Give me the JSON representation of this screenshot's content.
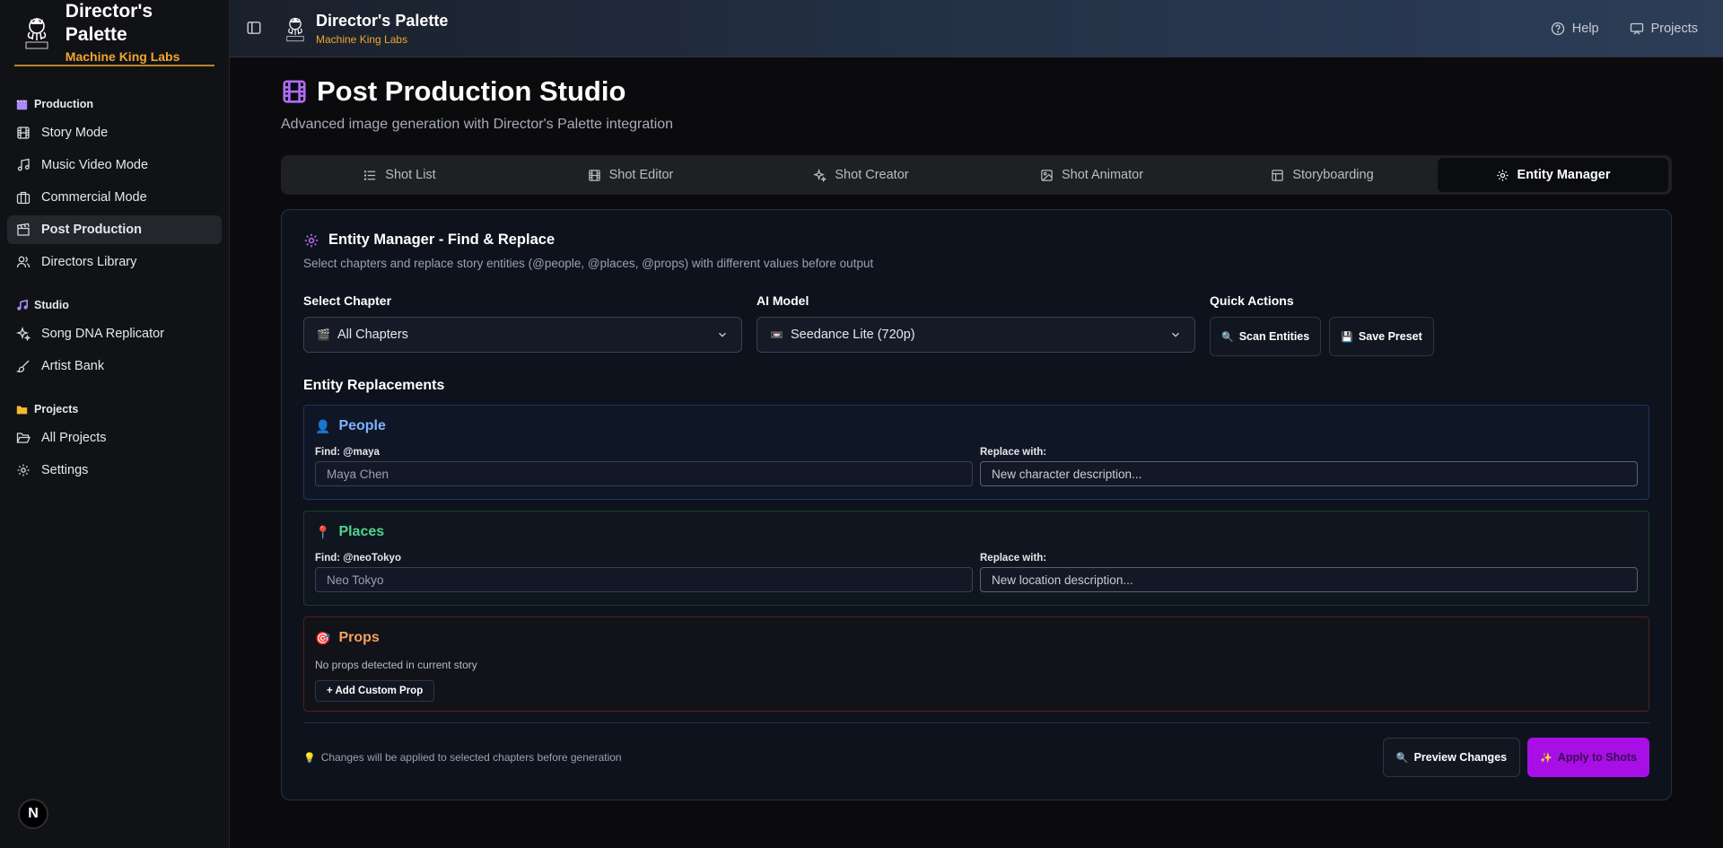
{
  "app": {
    "title": "Director's Palette",
    "subtitle": "Machine King Labs",
    "logo_text": "MACHINE KING LABS"
  },
  "sidebar": {
    "groups": [
      {
        "label": "Production",
        "icon": "clapperboard-icon",
        "items": [
          {
            "label": "Story Mode",
            "icon": "film-icon"
          },
          {
            "label": "Music Video Mode",
            "icon": "music-icon"
          },
          {
            "label": "Commercial Mode",
            "icon": "briefcase-icon"
          },
          {
            "label": "Post Production",
            "icon": "clapperboard-icon",
            "active": true
          },
          {
            "label": "Directors Library",
            "icon": "users-icon"
          }
        ]
      },
      {
        "label": "Studio",
        "icon": "music-note-icon",
        "items": [
          {
            "label": "Song DNA Replicator",
            "icon": "sparkles-icon"
          },
          {
            "label": "Artist Bank",
            "icon": "brush-icon"
          }
        ]
      },
      {
        "label": "Projects",
        "icon": "folder-icon",
        "items": [
          {
            "label": "All Projects",
            "icon": "folder-open-icon"
          },
          {
            "label": "Settings",
            "icon": "gear-icon"
          }
        ]
      }
    ],
    "user_badge": "N"
  },
  "topbar": {
    "title": "Director's Palette",
    "subtitle": "Machine King Labs",
    "links": [
      {
        "label": "Help",
        "icon": "help-circle-icon"
      },
      {
        "label": "Projects",
        "icon": "presentation-icon"
      }
    ]
  },
  "page": {
    "title": "Post Production Studio",
    "subtitle": "Advanced image generation with Director's Palette integration",
    "tabs": [
      {
        "label": "Shot List",
        "icon": "list-icon"
      },
      {
        "label": "Shot Editor",
        "icon": "film-icon"
      },
      {
        "label": "Shot Creator",
        "icon": "sparkles-icon"
      },
      {
        "label": "Shot Animator",
        "icon": "image-icon"
      },
      {
        "label": "Storyboarding",
        "icon": "layout-icon"
      },
      {
        "label": "Entity Manager",
        "icon": "gear-icon",
        "active": true
      }
    ]
  },
  "entity_manager": {
    "title": "Entity Manager - Find & Replace",
    "description": "Select chapters and replace story entities (@people, @places, @props) with different values before output",
    "select_chapter": {
      "label": "Select Chapter",
      "value": "All Chapters",
      "emoji": "🎬"
    },
    "ai_model": {
      "label": "AI Model",
      "value": "Seedance Lite (720p)",
      "emoji": "📼"
    },
    "quick_actions": {
      "label": "Quick Actions",
      "scan": "Scan Entities",
      "scan_emoji": "🔍",
      "save": "Save Preset",
      "save_emoji": "💾"
    },
    "replacements_label": "Entity Replacements",
    "people": {
      "title": "People",
      "emoji": "👤",
      "find_label": "Find: @maya",
      "find_value": "Maya Chen",
      "replace_label": "Replace with:",
      "replace_placeholder": "New character description..."
    },
    "places": {
      "title": "Places",
      "emoji": "📍",
      "find_label": "Find: @neoTokyo",
      "find_value": "Neo Tokyo",
      "replace_label": "Replace with:",
      "replace_placeholder": "New location description..."
    },
    "props": {
      "title": "Props",
      "emoji": "🎯",
      "empty_text": "No props detected in current story",
      "add_button": "+ Add Custom Prop"
    },
    "footer": {
      "tip_emoji": "💡",
      "tip": "Changes will be applied to selected chapters before generation",
      "preview_emoji": "🔍",
      "preview": "Preview Changes",
      "apply_emoji": "✨",
      "apply": "Apply to Shots"
    }
  },
  "colors": {
    "accent_purple": "#a80fe6",
    "brand_gold": "#f0a630",
    "people_blue": "#7fb2ff",
    "places_green": "#4fd68a",
    "props_orange": "#f5a25a"
  }
}
